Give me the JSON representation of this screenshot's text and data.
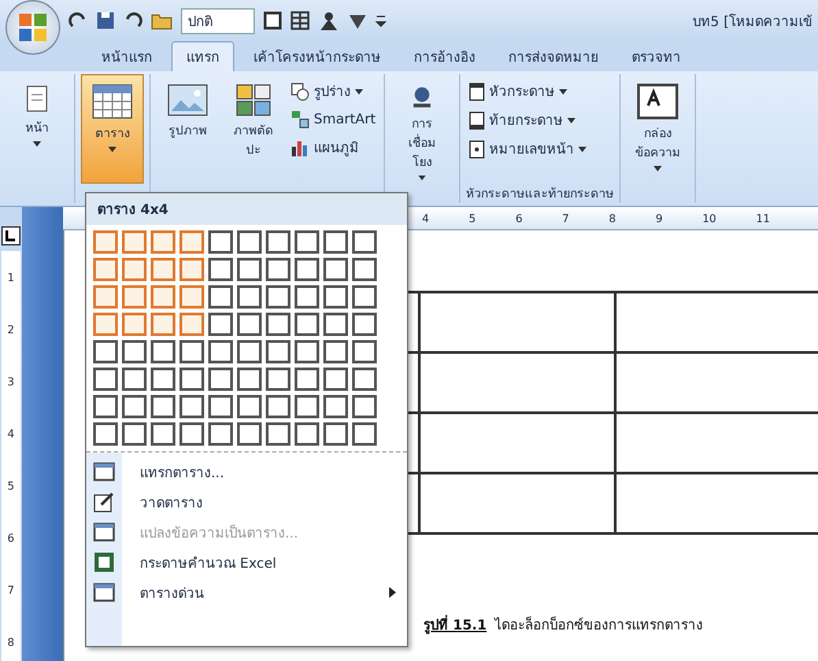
{
  "window": {
    "title": "บท5 [โหมดความเข้"
  },
  "quick_access": {
    "style_box": "ปกติ"
  },
  "tabs": [
    {
      "label": "หน้าแรก",
      "selected": false
    },
    {
      "label": "แทรก",
      "selected": true
    },
    {
      "label": "เค้าโครงหน้ากระดาษ",
      "selected": false
    },
    {
      "label": "การอ้างอิง",
      "selected": false
    },
    {
      "label": "การส่งจดหมาย",
      "selected": false
    },
    {
      "label": "ตรวจทา",
      "selected": false
    }
  ],
  "ribbon": [
    {
      "kind": "large",
      "label": "หน้า",
      "pressed": false
    },
    {
      "kind": "large",
      "label": "ตาราง",
      "pressed": true
    },
    {
      "kind": "illustrations",
      "items": [
        {
          "label": "รูปภาพ"
        },
        {
          "label": "ภาพตัดปะ"
        }
      ],
      "small": [
        {
          "label": "รูปร่าง",
          "dropdown": true
        },
        {
          "label": "SmartArt",
          "dropdown": false
        },
        {
          "label": "แผนภูมิ",
          "dropdown": false
        }
      ]
    },
    {
      "kind": "large",
      "label": "การเชื่อมโยง",
      "pressed": false
    },
    {
      "kind": "stack",
      "label": "หัวกระดาษและท้ายกระดาษ",
      "small": [
        {
          "label": "หัวกระดาษ",
          "dropdown": true
        },
        {
          "label": "ท้ายกระดาษ",
          "dropdown": true
        },
        {
          "label": "หมายเลขหน้า",
          "dropdown": true
        }
      ]
    },
    {
      "kind": "large",
      "label": "กล่องข้อความ",
      "pressed": false
    }
  ],
  "ruler": [
    "4",
    "5",
    "6",
    "7",
    "8",
    "9",
    "10",
    "11"
  ],
  "vertical_ruler": [
    "1",
    "2",
    "3",
    "4",
    "5",
    "6",
    "7",
    "8"
  ],
  "table_menu": {
    "title": "ตาราง 4x4",
    "grid": [
      {
        "cells": [
          {
            "selected": true
          },
          {
            "selected": true
          },
          {
            "selected": true
          },
          {
            "selected": true
          },
          {
            "selected": false
          },
          {
            "selected": false
          },
          {
            "selected": false
          },
          {
            "selected": false
          },
          {
            "selected": false
          },
          {
            "selected": false
          }
        ]
      },
      {
        "cells": [
          {
            "selected": true
          },
          {
            "selected": true
          },
          {
            "selected": true
          },
          {
            "selected": true
          },
          {
            "selected": false
          },
          {
            "selected": false
          },
          {
            "selected": false
          },
          {
            "selected": false
          },
          {
            "selected": false
          },
          {
            "selected": false
          }
        ]
      },
      {
        "cells": [
          {
            "selected": true
          },
          {
            "selected": true
          },
          {
            "selected": true
          },
          {
            "selected": true
          },
          {
            "selected": false
          },
          {
            "selected": false
          },
          {
            "selected": false
          },
          {
            "selected": false
          },
          {
            "selected": false
          },
          {
            "selected": false
          }
        ]
      },
      {
        "cells": [
          {
            "selected": true
          },
          {
            "selected": true
          },
          {
            "selected": true
          },
          {
            "selected": true
          },
          {
            "selected": false
          },
          {
            "selected": false
          },
          {
            "selected": false
          },
          {
            "selected": false
          },
          {
            "selected": false
          },
          {
            "selected": false
          }
        ]
      },
      {
        "cells": [
          {
            "selected": false
          },
          {
            "selected": false
          },
          {
            "selected": false
          },
          {
            "selected": false
          },
          {
            "selected": false
          },
          {
            "selected": false
          },
          {
            "selected": false
          },
          {
            "selected": false
          },
          {
            "selected": false
          },
          {
            "selected": false
          }
        ]
      },
      {
        "cells": [
          {
            "selected": false
          },
          {
            "selected": false
          },
          {
            "selected": false
          },
          {
            "selected": false
          },
          {
            "selected": false
          },
          {
            "selected": false
          },
          {
            "selected": false
          },
          {
            "selected": false
          },
          {
            "selected": false
          },
          {
            "selected": false
          }
        ]
      },
      {
        "cells": [
          {
            "selected": false
          },
          {
            "selected": false
          },
          {
            "selected": false
          },
          {
            "selected": false
          },
          {
            "selected": false
          },
          {
            "selected": false
          },
          {
            "selected": false
          },
          {
            "selected": false
          },
          {
            "selected": false
          },
          {
            "selected": false
          }
        ]
      },
      {
        "cells": [
          {
            "selected": false
          },
          {
            "selected": false
          },
          {
            "selected": false
          },
          {
            "selected": false
          },
          {
            "selected": false
          },
          {
            "selected": false
          },
          {
            "selected": false
          },
          {
            "selected": false
          },
          {
            "selected": false
          },
          {
            "selected": false
          }
        ]
      }
    ],
    "items": [
      {
        "label": "แทรกตาราง...",
        "disabled": false,
        "submenu": false
      },
      {
        "label": "วาดตาราง",
        "disabled": false,
        "submenu": false
      },
      {
        "label": "แปลงข้อความเป็นตาราง...",
        "disabled": true,
        "submenu": false
      },
      {
        "label": "กระดาษคำนวณ Excel",
        "disabled": false,
        "submenu": false
      },
      {
        "label": "ตารางด่วน",
        "disabled": false,
        "submenu": true
      }
    ]
  },
  "document": {
    "caption": {
      "label": "รูปที่ 15.1",
      "text": "ไดอะล็อกบ็อกซ์ของการแทรกตาราง"
    }
  }
}
